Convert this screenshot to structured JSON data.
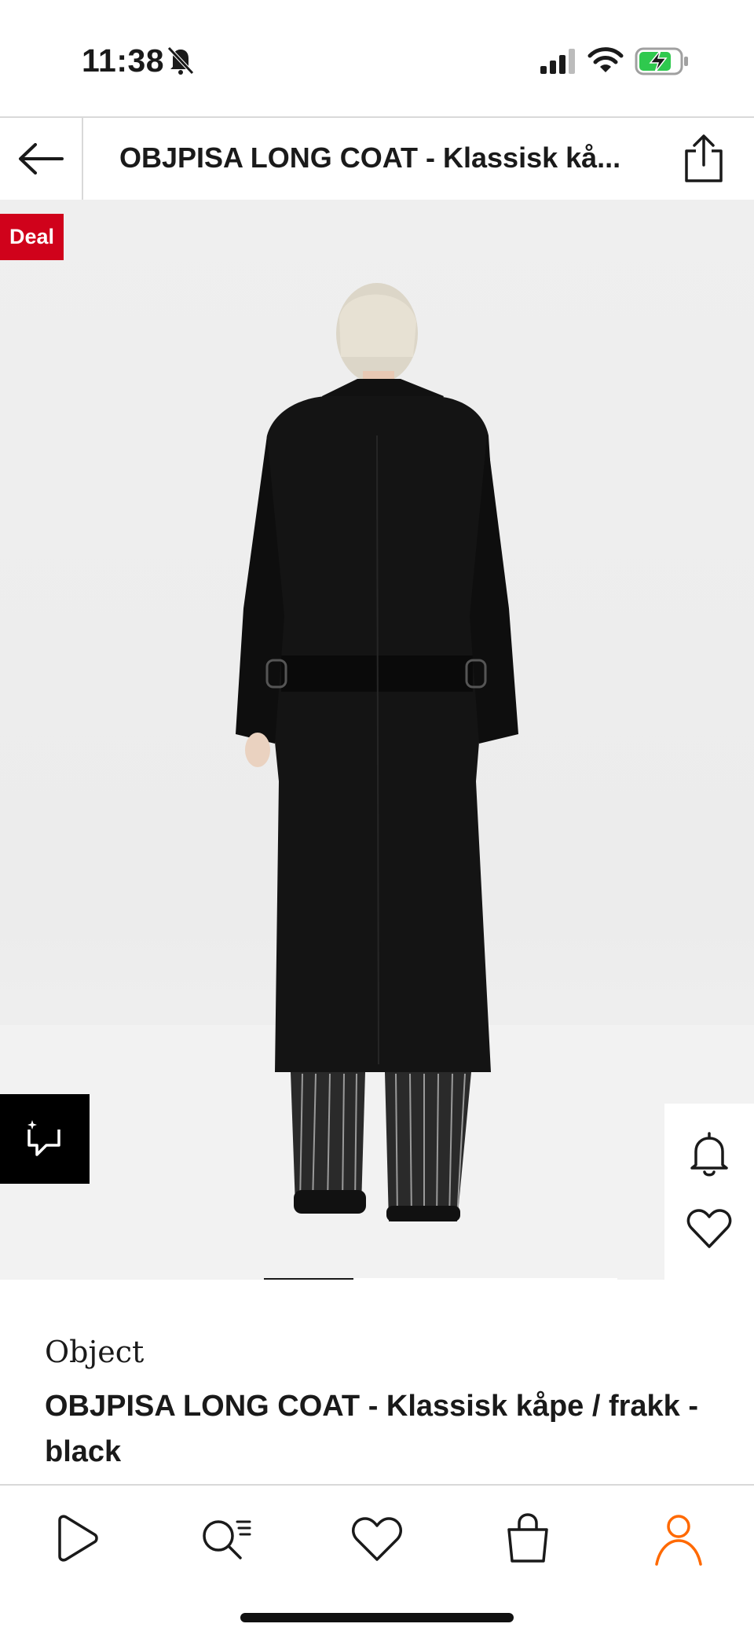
{
  "status_bar": {
    "time": "11:38",
    "icons": [
      "bell-off-icon",
      "signal-icon",
      "wifi-icon",
      "battery-charging-icon"
    ],
    "battery_color": "#2fc94e"
  },
  "header": {
    "title": "OBJPISA LONG COAT - Klassisk kå...",
    "back_icon": "arrow-left-icon",
    "share_icon": "share-icon"
  },
  "gallery": {
    "badge": "Deal",
    "badge_color": "#d0021b",
    "image_alt": "Model wearing black long coat, back view",
    "scan_icon": "visual-search-icon",
    "side_icons": [
      "bell-icon",
      "heart-icon"
    ],
    "carousel_position": 1
  },
  "product": {
    "brand": "Object",
    "name": "OBJPISA LONG COAT - Klassisk kåpe / frakk - black"
  },
  "bottom_nav": {
    "items": [
      {
        "icon": "play-icon",
        "name": "home"
      },
      {
        "icon": "search-list-icon",
        "name": "search"
      },
      {
        "icon": "heart-icon",
        "name": "wishlist"
      },
      {
        "icon": "bag-icon",
        "name": "bag"
      },
      {
        "icon": "person-icon",
        "name": "account",
        "active": true
      }
    ],
    "active_color": "#ff6900"
  }
}
